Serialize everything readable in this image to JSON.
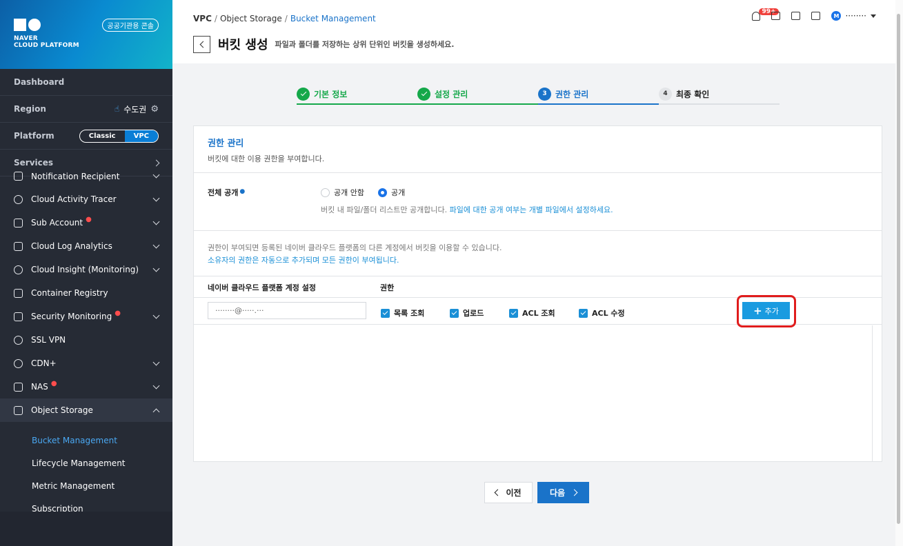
{
  "sidebar": {
    "logo_text_1": "NAVER",
    "logo_text_2": "CLOUD PLATFORM",
    "public_badge": "공공기관용 콘솔",
    "dashboard": "Dashboard",
    "region_label": "Region",
    "region_value": "수도권",
    "platform_label": "Platform",
    "platform_classic": "Classic",
    "platform_vpc": "VPC",
    "services_label": "Services",
    "menu": [
      {
        "label": "Notification Recipient",
        "icon": "user-card-icon",
        "expandable": true,
        "new": false
      },
      {
        "label": "Cloud Activity Tracer",
        "icon": "activity-icon",
        "expandable": true,
        "new": false
      },
      {
        "label": "Sub Account",
        "icon": "users-icon",
        "expandable": true,
        "new": true
      },
      {
        "label": "Cloud Log Analytics",
        "icon": "log-icon",
        "expandable": true,
        "new": false
      },
      {
        "label": "Cloud Insight (Monitoring)",
        "icon": "monitor-icon",
        "expandable": true,
        "new": false
      },
      {
        "label": "Container Registry",
        "icon": "registry-icon",
        "expandable": false,
        "new": false
      },
      {
        "label": "Security Monitoring",
        "icon": "shield-icon",
        "expandable": true,
        "new": true
      },
      {
        "label": "SSL VPN",
        "icon": "vpn-icon",
        "expandable": false,
        "new": false
      },
      {
        "label": "CDN+",
        "icon": "cdn-icon",
        "expandable": true,
        "new": false
      },
      {
        "label": "NAS",
        "icon": "nas-icon",
        "expandable": true,
        "new": true
      },
      {
        "label": "Object Storage",
        "icon": "storage-icon",
        "expandable": true,
        "new": false
      }
    ],
    "submenu": [
      "Bucket Management",
      "Lifecycle Management",
      "Metric Management",
      "Subscription"
    ]
  },
  "header": {
    "crumb_1": "VPC",
    "crumb_2": "Object Storage",
    "crumb_3": "Bucket Management",
    "title": "버킷 생성",
    "description": "파일과 폴더를 저장하는 상위 단위인 버킷을 생성하세요.",
    "notif_count": "99+",
    "user_initial": "M",
    "user_name": "········"
  },
  "steps": [
    {
      "num": "1",
      "label": "기본 정보",
      "state": "done"
    },
    {
      "num": "2",
      "label": "설정 관리",
      "state": "done"
    },
    {
      "num": "3",
      "label": "권한 관리",
      "state": "active"
    },
    {
      "num": "4",
      "label": "최종 확인",
      "state": "todo"
    }
  ],
  "card": {
    "title": "권한 관리",
    "subtitle": "버킷에 대한 이용 권한을 부여합니다.",
    "public_label": "전체 공개",
    "radio_private": "공개 안함",
    "radio_public": "공개",
    "public_help": "버킷 내 파일/폴더 리스트만 공개합니다.",
    "public_help_link": "파일에 대한 공개 여부는 개별 파일에서 설정하세요.",
    "info_line_1": "권한이 부여되면 등록된 네이버 클라우드 플랫폼의 다른 계정에서 버킷을 이용할 수 있습니다.",
    "info_line_2": "소유자의 권한은 자동으로 추가되며 모든 권한이 부여됩니다.",
    "col_account": "네이버 클라우드 플랫폼 계정 설정",
    "col_permission": "권한",
    "account_value": "········@·····.···",
    "perm_list": "목록 조회",
    "perm_upload": "업로드",
    "perm_acl_read": "ACL 조회",
    "perm_acl_write": "ACL 수정",
    "add_button": "추가"
  },
  "nav": {
    "prev": "이전",
    "next": "다음"
  }
}
